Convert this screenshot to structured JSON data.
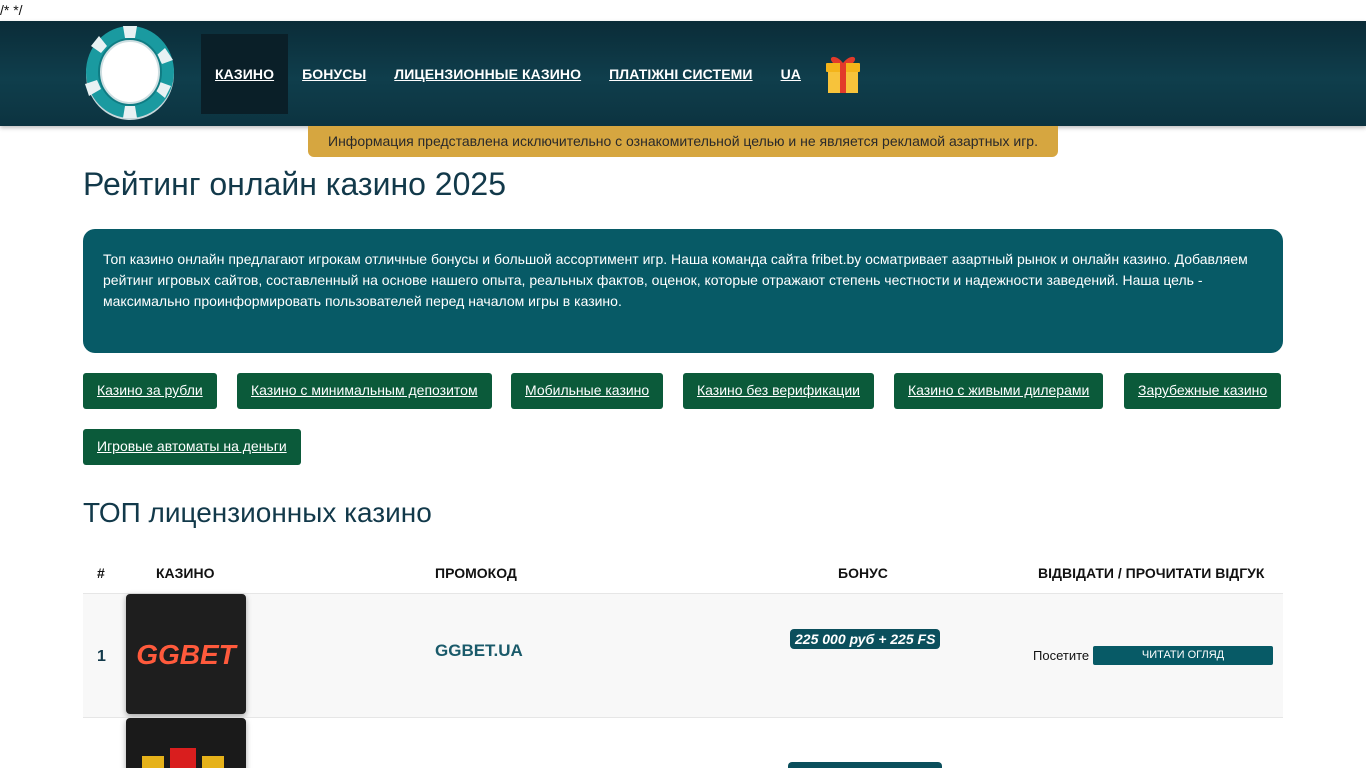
{
  "css_leak": "/* */",
  "nav": {
    "items": [
      {
        "label": "КАЗИНО",
        "active": true
      },
      {
        "label": "БОНУСЫ",
        "active": false
      },
      {
        "label": "ЛИЦЕНЗИОННЫЕ КАЗИНО",
        "active": false
      },
      {
        "label": "ПЛАТІЖНІ СИСТЕМИ",
        "active": false
      },
      {
        "label": "UA",
        "active": false
      }
    ],
    "gift_icon": "gift-icon"
  },
  "notice": "Информация представлена исключительно с ознакомительной целью и не является рекламой азартных игр.",
  "title": "Рейтинг онлайн казино 2025",
  "intro": "Топ казино онлайн предлагают игрокам отличные бонусы и большой ассортимент игр. Наша команда сайта fribet.by осматривает азартный рынок и онлайн казино. Добавляем рейтинг игровых сайтов, составленный на основе нашего опыта, реальных фактов, оценок, которые отражают степень честности и надежности заведений. Наша цель - максимально проинформировать пользователей перед началом игры в казино.",
  "chips": [
    "Казино за рубли",
    "Казино с минимальным депозитом",
    "Мобильные казино",
    "Казино без верификации",
    "Казино с живыми дилерами",
    "Зарубежные казино",
    "Игровые автоматы на деньги"
  ],
  "top_title": "ТОП лицензионных казино",
  "table": {
    "headers": {
      "rank": "#",
      "casino": "КАЗИНО",
      "promo": "ПРОМОКОД",
      "bonus": "БОНУС",
      "action": "ВІДВІДАТИ / ПРОЧИТАТИ ВІДГУК"
    },
    "rows": [
      {
        "rank": "1",
        "logo_text": "GGBET",
        "promo": "GGBET.UA",
        "bonus": "225 000 руб + 225 FS",
        "visit": "Посетите",
        "review": "ЧИТАТИ ОГЛЯД"
      }
    ]
  },
  "colors": {
    "header_bg": "#0f3e4c",
    "notice_bg": "#d6a640",
    "intro_bg": "#075a66",
    "chip_bg": "#0b5a3a"
  }
}
